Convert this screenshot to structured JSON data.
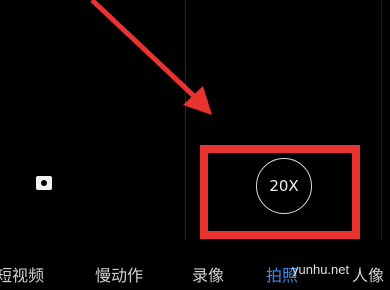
{
  "camera": {
    "zoom_label": "20X",
    "modes": [
      {
        "label": "短视频",
        "active": false
      },
      {
        "label": "慢动作",
        "active": false
      },
      {
        "label": "录像",
        "active": false
      },
      {
        "label": "拍照",
        "active": true
      },
      {
        "label": "人像",
        "active": false
      }
    ]
  },
  "annotation": {
    "highlight_color": "#e8332f",
    "watermark": "yunhu.net"
  },
  "icons": {
    "macro": "macro-mode-icon",
    "arrow": "pointer-arrow-icon"
  },
  "colors": {
    "active_mode": "#3a8df0",
    "inactive_mode": "#cfcfcf",
    "background": "#000000"
  }
}
